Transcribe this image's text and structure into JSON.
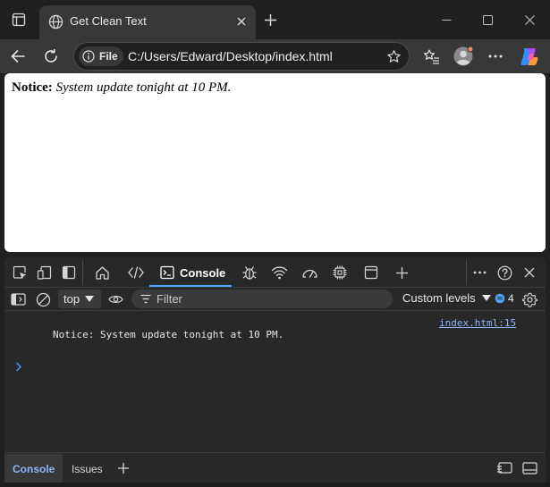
{
  "window": {
    "tab_title": "Get Clean Text"
  },
  "toolbar": {
    "site_badge": "File",
    "url": "C:/Users/Edward/Desktop/index.html"
  },
  "page": {
    "notice_label": "Notice:",
    "notice_text": "System update tonight at 10 PM."
  },
  "devtools": {
    "tabs": [
      {
        "icon": "inspect-icon"
      },
      {
        "icon": "device-emulation-icon"
      },
      {
        "icon": "dock-sidebar-icon"
      },
      {
        "icon": "home-icon"
      },
      {
        "icon": "elements-icon"
      },
      {
        "label": "Console",
        "icon": "console-icon",
        "active": true
      },
      {
        "icon": "sources-bug-icon"
      },
      {
        "icon": "network-wifi-icon"
      },
      {
        "icon": "performance-gauge-icon"
      },
      {
        "icon": "memory-chip-icon"
      },
      {
        "icon": "application-panel-icon"
      },
      {
        "icon": "add-panel-icon"
      }
    ],
    "context": "top",
    "filter_placeholder": "Filter",
    "levels": "Custom levels",
    "issues_count": "4",
    "log": {
      "message": "Notice: System update tonight at 10 PM.",
      "source": "index.html:15"
    },
    "drawer": {
      "tabs": [
        "Console",
        "Issues"
      ]
    }
  },
  "colors": {
    "chrome_dark": "#202020",
    "toolbar": "#383838",
    "devtools_bg": "#282828",
    "accent": "#4da3ff",
    "link": "#8ab4f8"
  }
}
